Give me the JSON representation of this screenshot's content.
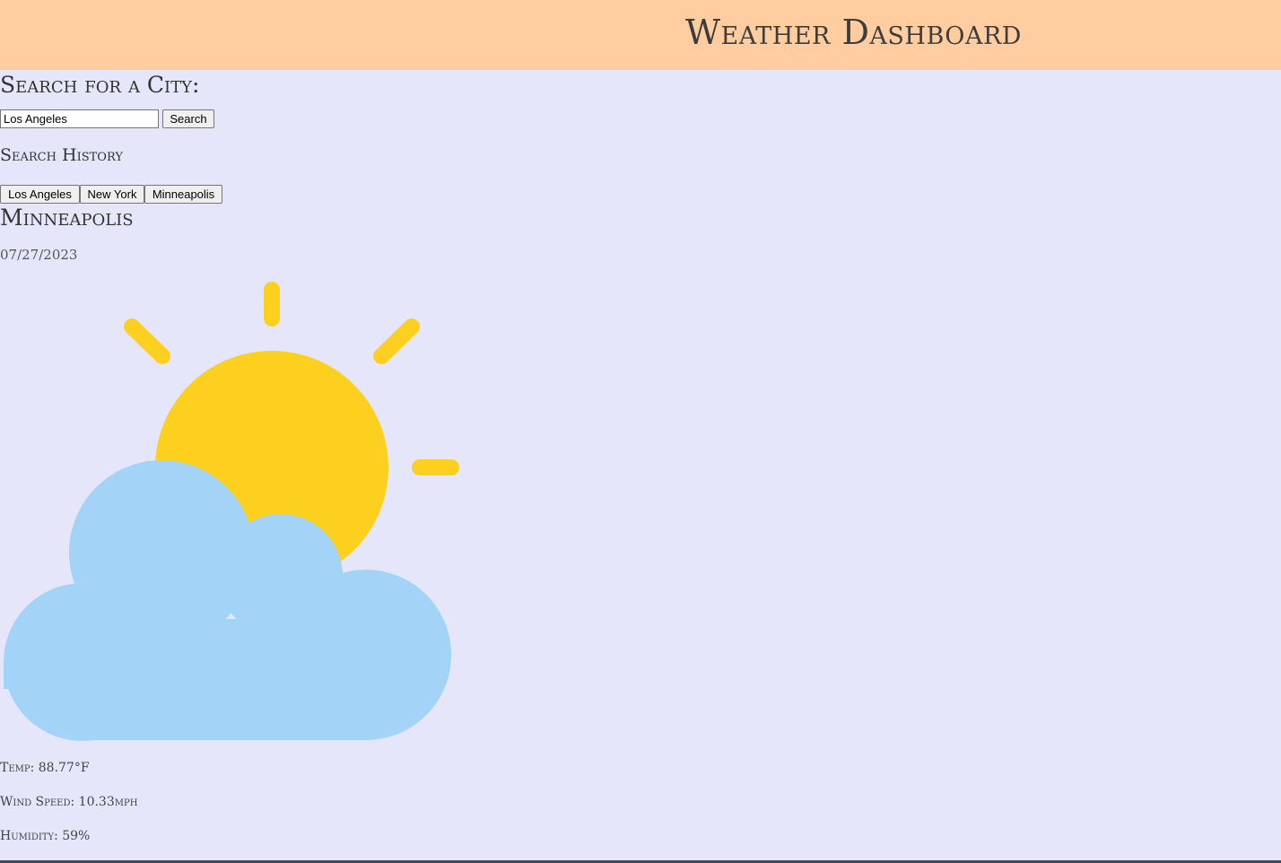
{
  "header": {
    "title": "Weather Dashboard"
  },
  "search": {
    "heading": "Search for a City:",
    "input_value": "Los Angeles",
    "button_label": "Search"
  },
  "history": {
    "heading": "Search History",
    "items": [
      {
        "label": "Los Angeles"
      },
      {
        "label": "New York"
      },
      {
        "label": "Minneapolis"
      }
    ]
  },
  "current": {
    "city": "Minneapolis",
    "date": "07/27/2023",
    "icon": "partly-cloudy-icon",
    "temp": "Temp: 88.77°F",
    "wind": "Wind Speed: 10.33mph",
    "humidity": "Humidity: 59%"
  },
  "colors": {
    "header_bg": "#ffcda0",
    "page_bg": "#e5e6f9",
    "sun": "#fdd020",
    "cloud": "#a3d3f6"
  }
}
